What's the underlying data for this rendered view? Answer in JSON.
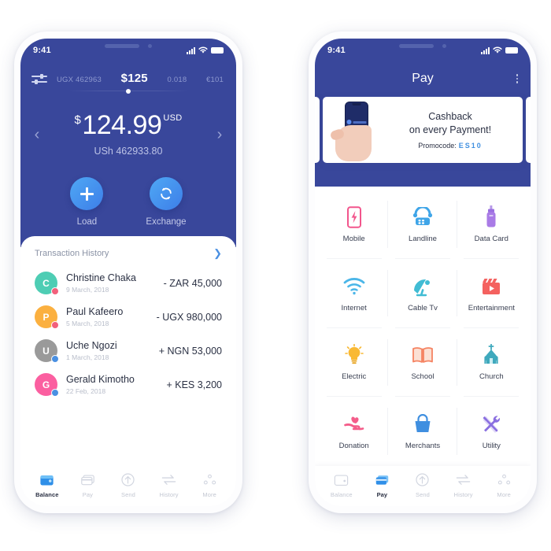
{
  "theme": {
    "brand_blue": "#39479b",
    "accent_blue": "#3f8fe0",
    "text_dark": "#2a3043",
    "muted": "#b8bdca"
  },
  "left_phone": {
    "status_bar": {
      "time": "9:41",
      "signal_icon": "signal-bars-icon",
      "wifi_icon": "wifi-icon",
      "battery_icon": "battery-icon"
    },
    "currency_selector": {
      "filter_icon": "filter-sliders-icon",
      "options": [
        {
          "label": "UGX 462963",
          "active": false
        },
        {
          "label": "$125",
          "active": true
        },
        {
          "label": "0.018",
          "active": false
        },
        {
          "label": "€101",
          "active": false
        }
      ]
    },
    "balance": {
      "prev_icon": "chevron-left-icon",
      "next_icon": "chevron-right-icon",
      "symbol": "$",
      "amount": "124.99",
      "currency": "USD",
      "secondary": "USh 462933.80"
    },
    "actions": [
      {
        "label": "Load",
        "icon": "plus-icon"
      },
      {
        "label": "Exchange",
        "icon": "exchange-refresh-icon"
      }
    ],
    "transactions_header": {
      "title": "Transaction History",
      "arrow_icon": "chevron-right-icon"
    },
    "transactions": [
      {
        "initial": "C",
        "name": "Christine Chaka",
        "date": "9 March, 2018",
        "amount": "- ZAR 45,000",
        "color": "#4ecdb4",
        "badge_color": "#f2607b"
      },
      {
        "initial": "P",
        "name": "Paul Kafeero",
        "date": "5 March, 2018",
        "amount": "- UGX 980,000",
        "color": "#fbb040",
        "badge_color": "#f2607b"
      },
      {
        "initial": "U",
        "name": "Uche Ngozi",
        "date": "1 March, 2018",
        "amount": "+ NGN 53,000",
        "color": "#9a9a9a",
        "badge_color": "#4a90e2"
      },
      {
        "initial": "G",
        "name": "Gerald Kimotho",
        "date": "22 Feb, 2018",
        "amount": "+ KES 3,200",
        "color": "#fb5fa0",
        "badge_color": "#4a90e2"
      }
    ],
    "bottom_nav": [
      {
        "label": "Balance",
        "icon": "wallet-icon",
        "active": true
      },
      {
        "label": "Pay",
        "icon": "cards-icon",
        "active": false
      },
      {
        "label": "Send",
        "icon": "send-up-arrow-icon",
        "active": false
      },
      {
        "label": "History",
        "icon": "exchange-arrows-icon",
        "active": false
      },
      {
        "label": "More",
        "icon": "more-dots-icon",
        "active": false
      }
    ]
  },
  "right_phone": {
    "status_bar": {
      "time": "9:41",
      "signal_icon": "signal-bars-icon",
      "wifi_icon": "wifi-icon",
      "battery_icon": "battery-icon"
    },
    "header": {
      "title": "Pay",
      "menu_icon": "kebab-menu-icon"
    },
    "banner": {
      "line1": "Cashback",
      "line2": "on every Payment!",
      "promo_label": "Promocode:",
      "promo_code": "ES10",
      "image_icon": "hand-holding-phone-icon"
    },
    "services": [
      {
        "label": "Mobile",
        "icon": "mobile-phone-icon",
        "color": "#f2558c"
      },
      {
        "label": "Landline",
        "icon": "landline-telephone-icon",
        "color": "#3fa5e8"
      },
      {
        "label": "Data Card",
        "icon": "usb-data-card-icon",
        "color": "#a36fe0"
      },
      {
        "label": "Internet",
        "icon": "wifi-icon",
        "color": "#4bb6e8"
      },
      {
        "label": "Cable Tv",
        "icon": "satellite-dish-icon",
        "color": "#41bcd4"
      },
      {
        "label": "Entertainment",
        "icon": "clapperboard-icon",
        "color": "#f4615f"
      },
      {
        "label": "Electric",
        "icon": "light-bulb-icon",
        "color": "#f9b934"
      },
      {
        "label": "School",
        "icon": "open-book-icon",
        "color": "#f58463"
      },
      {
        "label": "Church",
        "icon": "church-icon",
        "color": "#3fa9bd"
      },
      {
        "label": "Donation",
        "icon": "hand-heart-icon",
        "color": "#f45d8a"
      },
      {
        "label": "Merchants",
        "icon": "shopping-bag-icon",
        "color": "#3f8fe0"
      },
      {
        "label": "Utility",
        "icon": "tools-wrench-screwdriver-icon",
        "color": "#8a6fe0"
      }
    ],
    "bottom_nav": [
      {
        "label": "Balance",
        "icon": "wallet-icon",
        "active": false
      },
      {
        "label": "Pay",
        "icon": "cards-icon",
        "active": true
      },
      {
        "label": "Send",
        "icon": "send-up-arrow-icon",
        "active": false
      },
      {
        "label": "History",
        "icon": "exchange-arrows-icon",
        "active": false
      },
      {
        "label": "More",
        "icon": "more-dots-icon",
        "active": false
      }
    ]
  }
}
